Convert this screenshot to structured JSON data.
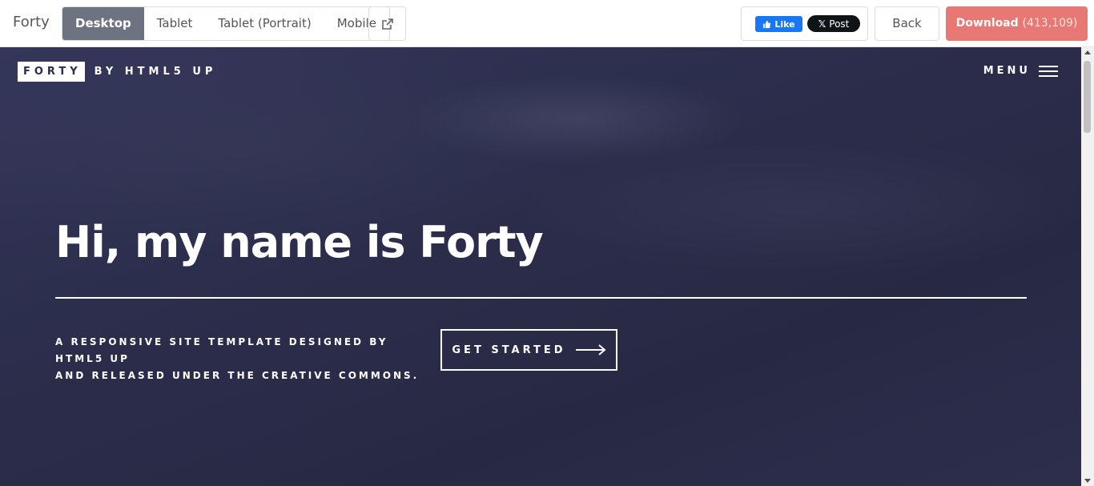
{
  "topbar": {
    "brand": "Forty",
    "devices": [
      {
        "label": "Desktop",
        "active": true
      },
      {
        "label": "Tablet",
        "active": false
      },
      {
        "label": "Tablet (Portrait)",
        "active": false
      },
      {
        "label": "Mobile",
        "active": false
      }
    ],
    "external_icon": "external-link-icon",
    "facebook_like_label": "Like",
    "x_post_label": "Post",
    "back_label": "Back",
    "download_label": "Download",
    "download_count": "(413,109)"
  },
  "preview": {
    "logo_box": "FORTY",
    "logo_by": "BY HTML5 UP",
    "menu_label": "MENU",
    "hero_title": "Hi, my name is Forty",
    "hero_sub_line1": "A RESPONSIVE SITE TEMPLATE DESIGNED BY HTML5 UP",
    "hero_sub_line2": "AND RELEASED UNDER THE CREATIVE COMMONS.",
    "cta_label": "GET STARTED"
  },
  "colors": {
    "download_bg": "#e87873",
    "active_device_bg": "#6e7381",
    "hero_bg": "#2b2c48",
    "facebook_blue": "#1877f2"
  }
}
